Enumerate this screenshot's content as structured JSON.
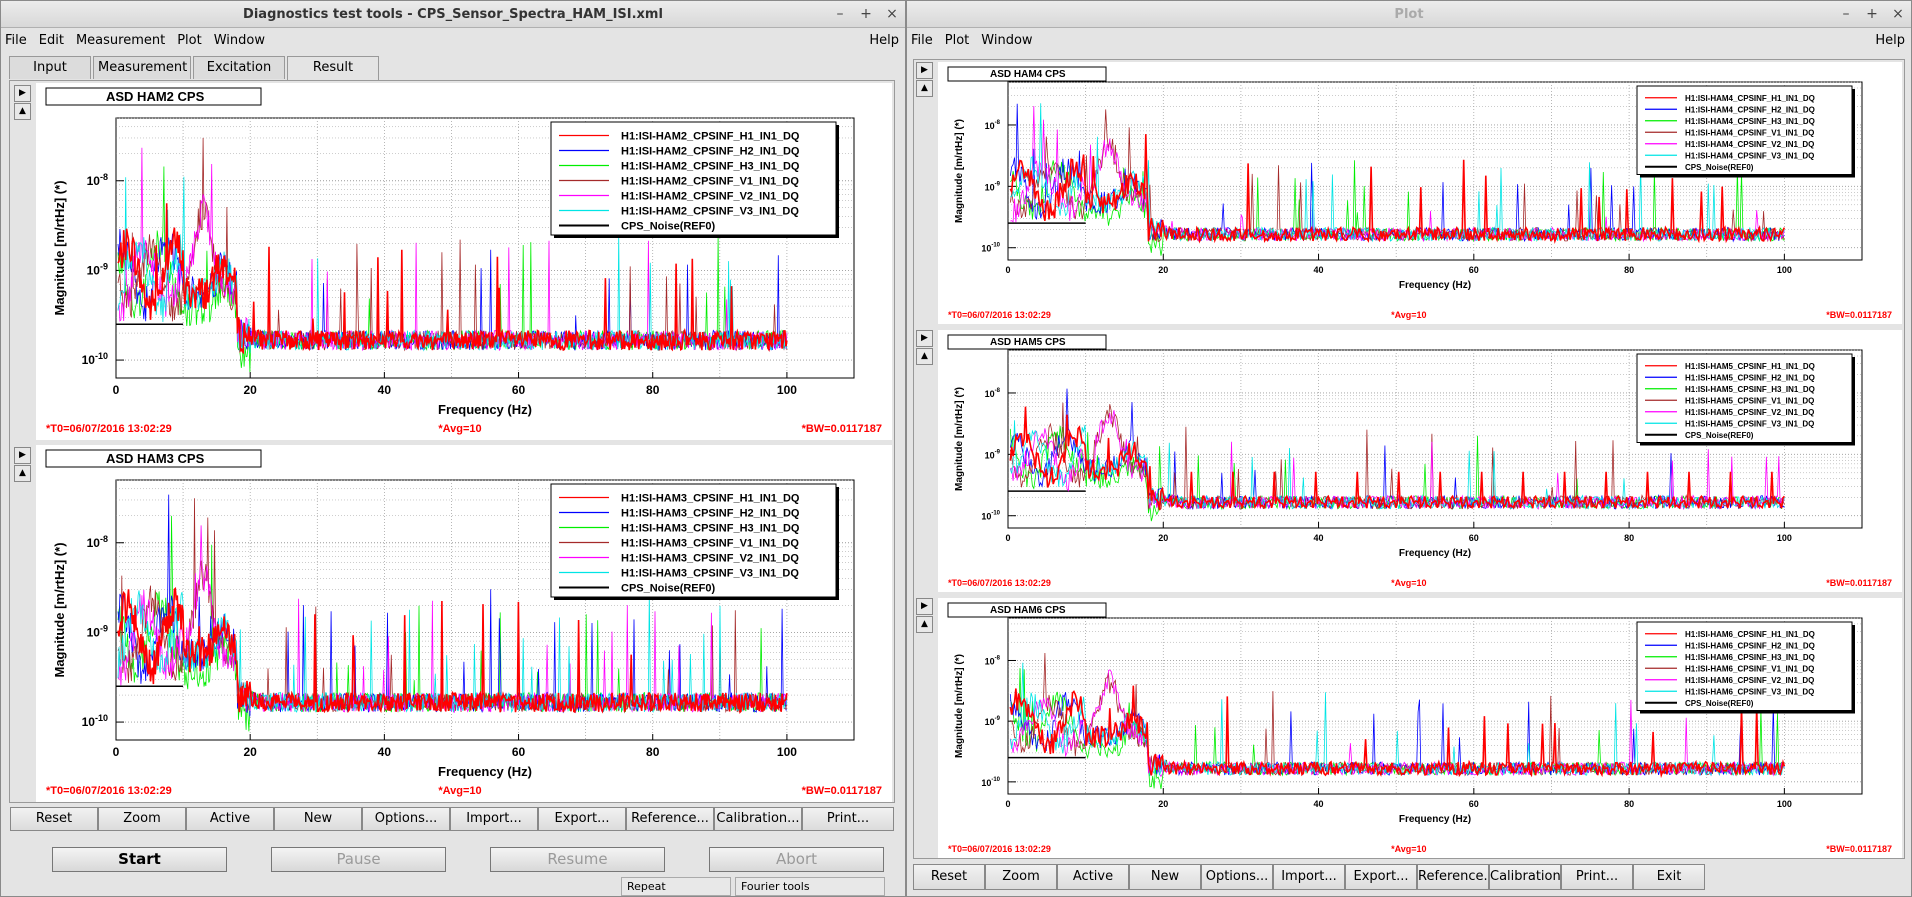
{
  "left_window": {
    "title": "Diagnostics test tools - CPS_Sensor_Spectra_HAM_ISI.xml",
    "menu": [
      "File",
      "Edit",
      "Measurement",
      "Plot",
      "Window"
    ],
    "help": "Help",
    "tabs": [
      "Input",
      "Measurement",
      "Excitation",
      "Result"
    ],
    "active_tab": "Result",
    "toolbar": [
      "Reset",
      "Zoom",
      "Active",
      "New",
      "Options...",
      "Import...",
      "Export...",
      "Reference...",
      "Calibration...",
      "Print..."
    ],
    "controls": {
      "start": "Start",
      "pause": "Pause",
      "resume": "Resume",
      "abort": "Abort"
    },
    "status": {
      "repeat": "Repeat",
      "fourier": "Fourier tools"
    }
  },
  "right_window": {
    "title": "Plot",
    "menu": [
      "File",
      "Plot",
      "Window"
    ],
    "help": "Help",
    "toolbar": [
      "Reset",
      "Zoom",
      "Active",
      "New",
      "Options...",
      "Import...",
      "Export...",
      "Reference...",
      "Calibration...",
      "Print...",
      "Exit"
    ]
  },
  "colors": {
    "series": [
      "#ff0000",
      "#0000ff",
      "#00ee00",
      "#a52a2a",
      "#ff00ff",
      "#00e5e5"
    ],
    "reference": "#000000",
    "footer": "#ff0000"
  },
  "plots": [
    {
      "id": "ham2",
      "title": "ASD HAM2 CPS",
      "ylabel": "Magnitude [m/rtHz] (*)",
      "xlabel": "Frequency (Hz)",
      "footer_t0": "*T0=06/07/2016 13:02:29",
      "footer_avg": "*Avg=10",
      "footer_bw": "*BW=0.0117187",
      "legend": [
        "H1:ISI-HAM2_CPSINF_H1_IN1_DQ",
        "H1:ISI-HAM2_CPSINF_H2_IN1_DQ",
        "H1:ISI-HAM2_CPSINF_H3_IN1_DQ",
        "H1:ISI-HAM2_CPSINF_V1_IN1_DQ",
        "H1:ISI-HAM2_CPSINF_V2_IN1_DQ",
        "H1:ISI-HAM2_CPSINF_V3_IN1_DQ",
        "CPS_Noise(REF0)"
      ],
      "xticks": [
        "0",
        "20",
        "40",
        "60",
        "80",
        "100"
      ],
      "yticks": [
        "10^-8",
        "10^-9",
        "10^-10"
      ]
    },
    {
      "id": "ham3",
      "title": "ASD HAM3 CPS",
      "ylabel": "Magnitude [m/rtHz] (*)",
      "xlabel": "Frequency (Hz)",
      "footer_t0": "*T0=06/07/2016 13:02:29",
      "footer_avg": "*Avg=10",
      "footer_bw": "*BW=0.0117187",
      "legend": [
        "H1:ISI-HAM3_CPSINF_H1_IN1_DQ",
        "H1:ISI-HAM3_CPSINF_H2_IN1_DQ",
        "H1:ISI-HAM3_CPSINF_H3_IN1_DQ",
        "H1:ISI-HAM3_CPSINF_V1_IN1_DQ",
        "H1:ISI-HAM3_CPSINF_V2_IN1_DQ",
        "H1:ISI-HAM3_CPSINF_V3_IN1_DQ",
        "CPS_Noise(REF0)"
      ],
      "xticks": [
        "0",
        "20",
        "40",
        "60",
        "80",
        "100"
      ],
      "yticks": [
        "10^-8",
        "10^-9",
        "10^-10"
      ]
    },
    {
      "id": "ham4",
      "title": "ASD HAM4 CPS",
      "ylabel": "Magnitude [m/rtHz] (*)",
      "xlabel": "Frequency (Hz)",
      "footer_t0": "*T0=06/07/2016 13:02:29",
      "footer_avg": "*Avg=10",
      "footer_bw": "*BW=0.0117187",
      "legend": [
        "H1:ISI-HAM4_CPSINF_H1_IN1_DQ",
        "H1:ISI-HAM4_CPSINF_H2_IN1_DQ",
        "H1:ISI-HAM4_CPSINF_H3_IN1_DQ",
        "H1:ISI-HAM4_CPSINF_V1_IN1_DQ",
        "H1:ISI-HAM4_CPSINF_V2_IN1_DQ",
        "H1:ISI-HAM4_CPSINF_V3_IN1_DQ",
        "CPS_Noise(REF0)"
      ],
      "xticks": [
        "0",
        "20",
        "40",
        "60",
        "80",
        "100"
      ],
      "yticks": [
        "10^-8",
        "10^-9",
        "10^-10"
      ]
    },
    {
      "id": "ham5",
      "title": "ASD HAM5 CPS",
      "ylabel": "Magnitude [m/rtHz] (*)",
      "xlabel": "Frequency (Hz)",
      "footer_t0": "*T0=06/07/2016 13:02:29",
      "footer_avg": "*Avg=10",
      "footer_bw": "*BW=0.0117187",
      "legend": [
        "H1:ISI-HAM5_CPSINF_H1_IN1_DQ",
        "H1:ISI-HAM5_CPSINF_H2_IN1_DQ",
        "H1:ISI-HAM5_CPSINF_H3_IN1_DQ",
        "H1:ISI-HAM5_CPSINF_V1_IN1_DQ",
        "H1:ISI-HAM5_CPSINF_V2_IN1_DQ",
        "H1:ISI-HAM5_CPSINF_V3_IN1_DQ",
        "CPS_Noise(REF0)"
      ],
      "xticks": [
        "0",
        "20",
        "40",
        "60",
        "80",
        "100"
      ],
      "yticks": [
        "10^-8",
        "10^-9",
        "10^-10"
      ]
    },
    {
      "id": "ham6",
      "title": "ASD HAM6 CPS",
      "ylabel": "Magnitude [m/rtHz] (*)",
      "xlabel": "Frequency (Hz)",
      "footer_t0": "*T0=06/07/2016 13:02:29",
      "footer_avg": "*Avg=10",
      "footer_bw": "*BW=0.0117187",
      "legend": [
        "H1:ISI-HAM6_CPSINF_H1_IN1_DQ",
        "H1:ISI-HAM6_CPSINF_H2_IN1_DQ",
        "H1:ISI-HAM6_CPSINF_H3_IN1_DQ",
        "H1:ISI-HAM6_CPSINF_V1_IN1_DQ",
        "H1:ISI-HAM6_CPSINF_V2_IN1_DQ",
        "H1:ISI-HAM6_CPSINF_V3_IN1_DQ",
        "CPS_Noise(REF0)"
      ],
      "xticks": [
        "0",
        "20",
        "40",
        "60",
        "80",
        "100"
      ],
      "yticks": [
        "10^-8",
        "10^-9",
        "10^-10"
      ]
    }
  ]
}
